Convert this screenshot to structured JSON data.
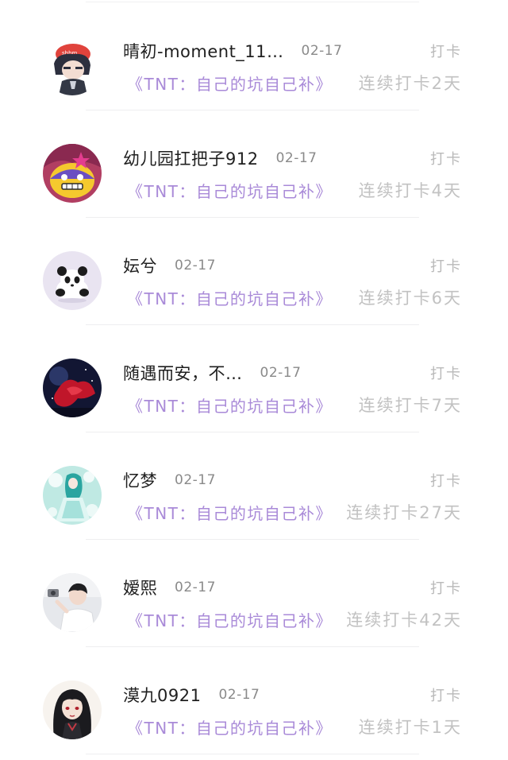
{
  "entries": [
    {
      "name": "晴初-moment_11…",
      "date": "02-17",
      "action": "打卡",
      "book": "《TNT：自己的坑自己补》",
      "streak": "连续打卡2天",
      "avatar_icon": "anime-boy-red-cap-avatar"
    },
    {
      "name": "幼儿园扛把子912",
      "date": "02-17",
      "action": "打卡",
      "book": "《TNT：自己的坑自己补》",
      "streak": "连续打卡4天",
      "avatar_icon": "cartoon-yellow-face-avatar"
    },
    {
      "name": "妘兮",
      "date": "02-17",
      "action": "打卡",
      "book": "《TNT：自己的坑自己补》",
      "streak": "连续打卡6天",
      "avatar_icon": "panda-avatar"
    },
    {
      "name": "随遇而安，不…",
      "date": "02-17",
      "action": "打卡",
      "book": "《TNT：自己的坑自己补》",
      "streak": "连续打卡7天",
      "avatar_icon": "red-moon-night-avatar"
    },
    {
      "name": "忆梦",
      "date": "02-17",
      "action": "打卡",
      "book": "《TNT：自己的坑自己补》",
      "streak": "连续打卡27天",
      "avatar_icon": "teal-dress-girl-avatar"
    },
    {
      "name": "嫒熙",
      "date": "02-17",
      "action": "打卡",
      "book": "《TNT：自己的坑自己补》",
      "streak": "连续打卡42天",
      "avatar_icon": "boy-photo-avatar"
    },
    {
      "name": "漠九0921",
      "date": "02-17",
      "action": "打卡",
      "book": "《TNT：自己的坑自己补》",
      "streak": "连续打卡1天",
      "avatar_icon": "dark-hair-anime-avatar"
    }
  ]
}
